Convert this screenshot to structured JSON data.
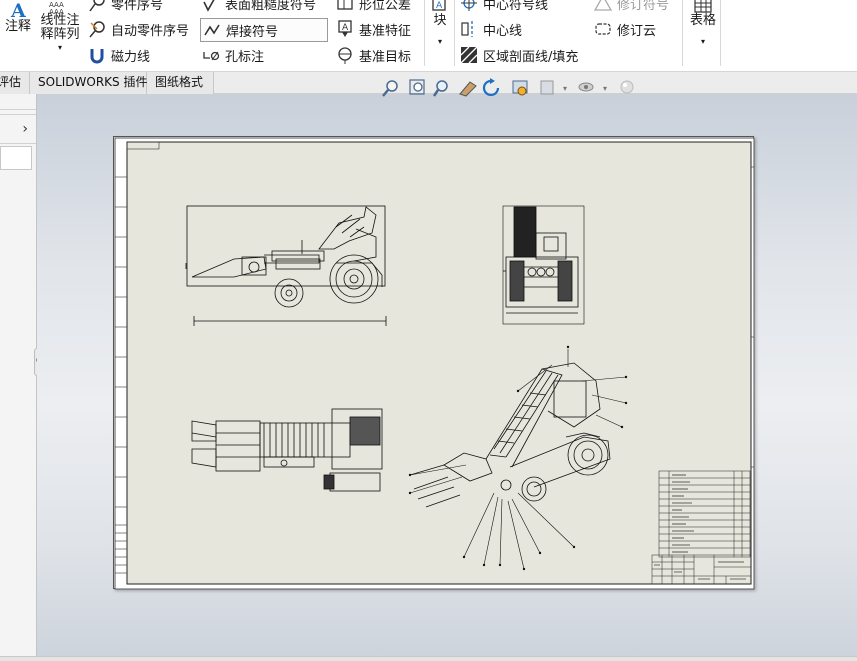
{
  "ribbon": {
    "annotation_label": "注释",
    "linear_pattern_line1": "线性注",
    "linear_pattern_line2": "释阵列",
    "balloon": "零件序号",
    "auto_balloon": "自动零件序号",
    "magnetic_line": "磁力线",
    "surface_finish": "表面粗糙度符号",
    "weld_symbol": "焊接符号",
    "hole_callout": "孔标注",
    "gtol": "形位公差",
    "datum_feature": "基准特征",
    "datum_target": "基准目标",
    "block_label": "块",
    "center_mark": "中心符号线",
    "centerline": "中心线",
    "area_hatch": "区域剖面线/填充",
    "revision_symbol": "修订符号",
    "revision_cloud": "修订云",
    "tables_label": "表格"
  },
  "tabs": [
    {
      "label": "评估"
    },
    {
      "label": "SOLIDWORKS 插件"
    },
    {
      "label": "图纸格式"
    }
  ],
  "colors": {
    "sheet_fill": "#e6e6dc",
    "line": "#111111",
    "accent_blue": "#1f6fc4"
  }
}
